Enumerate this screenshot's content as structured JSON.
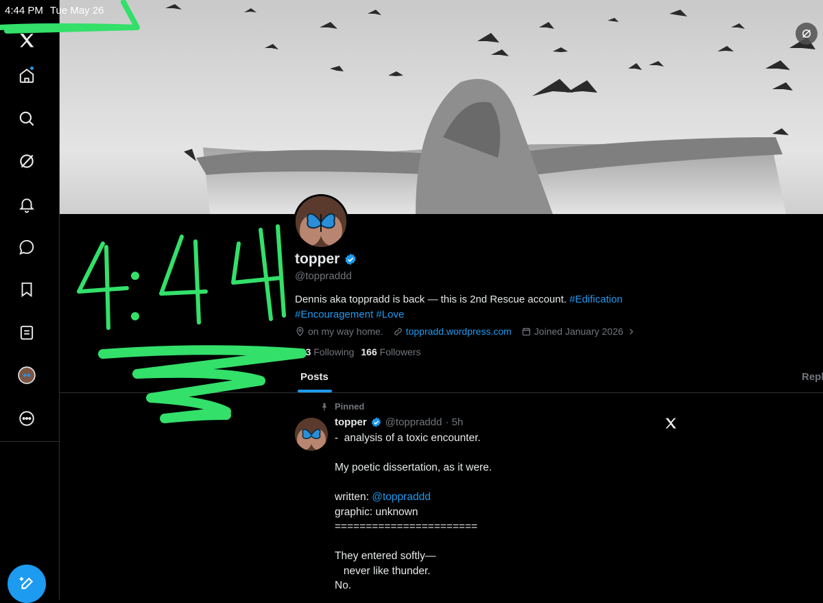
{
  "status_bar": {
    "time": "4:44 PM",
    "date": "Tue May 26"
  },
  "profile": {
    "name": "topper",
    "handle": "@toppraddd",
    "bio_text": "Dennis aka toppradd is back — this is 2nd Rescue account. ",
    "bio_tags_line1": "#Edification",
    "bio_tags_line2": "#Encouragement #Love",
    "location": "on my way home.",
    "website": "toppradd.wordpress.com",
    "joined": "Joined January 2026",
    "following_count": "343",
    "following_label": "Following",
    "followers_count": "166",
    "followers_label": "Followers"
  },
  "tabs": {
    "posts": "Posts",
    "replies": "Repli"
  },
  "post": {
    "pinned_label": "Pinned",
    "author_name": "topper",
    "author_handle": "@toppraddd",
    "time": "· 5h",
    "line1": "-  analysis of a toxic encounter.",
    "line2": "My poetic dissertation, as it were.",
    "written_prefix": "written: ",
    "written_mention": "@toppraddd",
    "graphic": "graphic: unknown",
    "separator": "=======================",
    "poem1": "They entered softly—",
    "poem2": "   never like thunder.",
    "poem3": "No."
  },
  "handwritten_overlay": "4:44",
  "colors": {
    "accent": "#1d9bf0",
    "marker": "#33e06a",
    "background": "#000000"
  },
  "icons": [
    "x-logo-icon",
    "home-icon",
    "search-icon",
    "grok-icon",
    "notifications-icon",
    "messages-icon",
    "bookmarks-icon",
    "lists-icon",
    "profile-avatar",
    "more-icon",
    "compose-icon"
  ]
}
